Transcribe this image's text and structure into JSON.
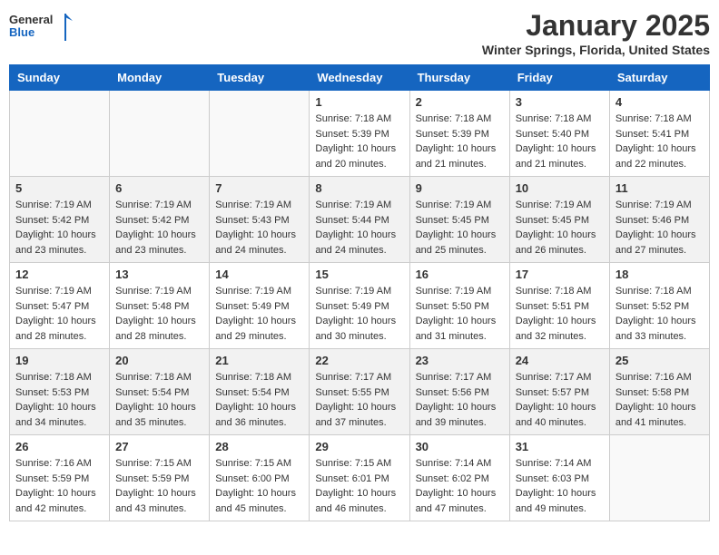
{
  "header": {
    "logo_general": "General",
    "logo_blue": "Blue",
    "month_year": "January 2025",
    "location": "Winter Springs, Florida, United States"
  },
  "days_of_week": [
    "Sunday",
    "Monday",
    "Tuesday",
    "Wednesday",
    "Thursday",
    "Friday",
    "Saturday"
  ],
  "weeks": [
    {
      "days": [
        {
          "number": "",
          "info": ""
        },
        {
          "number": "",
          "info": ""
        },
        {
          "number": "",
          "info": ""
        },
        {
          "number": "1",
          "info": "Sunrise: 7:18 AM\nSunset: 5:39 PM\nDaylight: 10 hours\nand 20 minutes."
        },
        {
          "number": "2",
          "info": "Sunrise: 7:18 AM\nSunset: 5:39 PM\nDaylight: 10 hours\nand 21 minutes."
        },
        {
          "number": "3",
          "info": "Sunrise: 7:18 AM\nSunset: 5:40 PM\nDaylight: 10 hours\nand 21 minutes."
        },
        {
          "number": "4",
          "info": "Sunrise: 7:18 AM\nSunset: 5:41 PM\nDaylight: 10 hours\nand 22 minutes."
        }
      ]
    },
    {
      "days": [
        {
          "number": "5",
          "info": "Sunrise: 7:19 AM\nSunset: 5:42 PM\nDaylight: 10 hours\nand 23 minutes."
        },
        {
          "number": "6",
          "info": "Sunrise: 7:19 AM\nSunset: 5:42 PM\nDaylight: 10 hours\nand 23 minutes."
        },
        {
          "number": "7",
          "info": "Sunrise: 7:19 AM\nSunset: 5:43 PM\nDaylight: 10 hours\nand 24 minutes."
        },
        {
          "number": "8",
          "info": "Sunrise: 7:19 AM\nSunset: 5:44 PM\nDaylight: 10 hours\nand 24 minutes."
        },
        {
          "number": "9",
          "info": "Sunrise: 7:19 AM\nSunset: 5:45 PM\nDaylight: 10 hours\nand 25 minutes."
        },
        {
          "number": "10",
          "info": "Sunrise: 7:19 AM\nSunset: 5:45 PM\nDaylight: 10 hours\nand 26 minutes."
        },
        {
          "number": "11",
          "info": "Sunrise: 7:19 AM\nSunset: 5:46 PM\nDaylight: 10 hours\nand 27 minutes."
        }
      ]
    },
    {
      "days": [
        {
          "number": "12",
          "info": "Sunrise: 7:19 AM\nSunset: 5:47 PM\nDaylight: 10 hours\nand 28 minutes."
        },
        {
          "number": "13",
          "info": "Sunrise: 7:19 AM\nSunset: 5:48 PM\nDaylight: 10 hours\nand 28 minutes."
        },
        {
          "number": "14",
          "info": "Sunrise: 7:19 AM\nSunset: 5:49 PM\nDaylight: 10 hours\nand 29 minutes."
        },
        {
          "number": "15",
          "info": "Sunrise: 7:19 AM\nSunset: 5:49 PM\nDaylight: 10 hours\nand 30 minutes."
        },
        {
          "number": "16",
          "info": "Sunrise: 7:19 AM\nSunset: 5:50 PM\nDaylight: 10 hours\nand 31 minutes."
        },
        {
          "number": "17",
          "info": "Sunrise: 7:18 AM\nSunset: 5:51 PM\nDaylight: 10 hours\nand 32 minutes."
        },
        {
          "number": "18",
          "info": "Sunrise: 7:18 AM\nSunset: 5:52 PM\nDaylight: 10 hours\nand 33 minutes."
        }
      ]
    },
    {
      "days": [
        {
          "number": "19",
          "info": "Sunrise: 7:18 AM\nSunset: 5:53 PM\nDaylight: 10 hours\nand 34 minutes."
        },
        {
          "number": "20",
          "info": "Sunrise: 7:18 AM\nSunset: 5:54 PM\nDaylight: 10 hours\nand 35 minutes."
        },
        {
          "number": "21",
          "info": "Sunrise: 7:18 AM\nSunset: 5:54 PM\nDaylight: 10 hours\nand 36 minutes."
        },
        {
          "number": "22",
          "info": "Sunrise: 7:17 AM\nSunset: 5:55 PM\nDaylight: 10 hours\nand 37 minutes."
        },
        {
          "number": "23",
          "info": "Sunrise: 7:17 AM\nSunset: 5:56 PM\nDaylight: 10 hours\nand 39 minutes."
        },
        {
          "number": "24",
          "info": "Sunrise: 7:17 AM\nSunset: 5:57 PM\nDaylight: 10 hours\nand 40 minutes."
        },
        {
          "number": "25",
          "info": "Sunrise: 7:16 AM\nSunset: 5:58 PM\nDaylight: 10 hours\nand 41 minutes."
        }
      ]
    },
    {
      "days": [
        {
          "number": "26",
          "info": "Sunrise: 7:16 AM\nSunset: 5:59 PM\nDaylight: 10 hours\nand 42 minutes."
        },
        {
          "number": "27",
          "info": "Sunrise: 7:15 AM\nSunset: 5:59 PM\nDaylight: 10 hours\nand 43 minutes."
        },
        {
          "number": "28",
          "info": "Sunrise: 7:15 AM\nSunset: 6:00 PM\nDaylight: 10 hours\nand 45 minutes."
        },
        {
          "number": "29",
          "info": "Sunrise: 7:15 AM\nSunset: 6:01 PM\nDaylight: 10 hours\nand 46 minutes."
        },
        {
          "number": "30",
          "info": "Sunrise: 7:14 AM\nSunset: 6:02 PM\nDaylight: 10 hours\nand 47 minutes."
        },
        {
          "number": "31",
          "info": "Sunrise: 7:14 AM\nSunset: 6:03 PM\nDaylight: 10 hours\nand 49 minutes."
        },
        {
          "number": "",
          "info": ""
        }
      ]
    }
  ]
}
